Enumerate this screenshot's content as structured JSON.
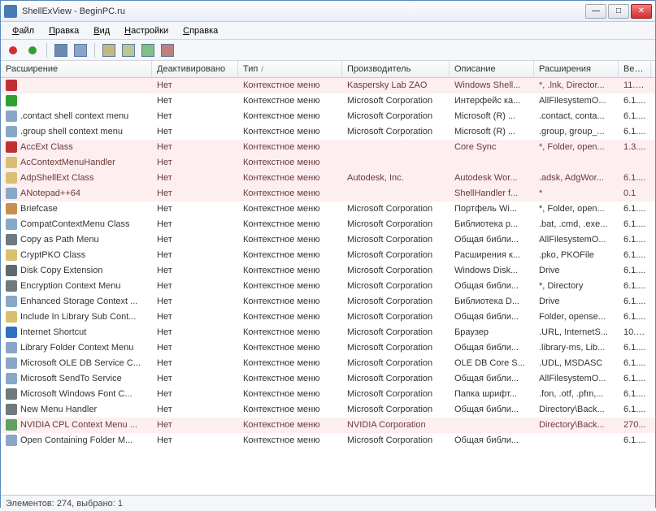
{
  "window": {
    "title": "ShellExView - BeginPC.ru"
  },
  "menu": {
    "file": "Файл",
    "edit": "Правка",
    "view": "Вид",
    "settings": "Настройки",
    "help": "Справка"
  },
  "columns": {
    "ext": "Расширение",
    "disabled": "Деактивировано",
    "type": "Тип",
    "sort": "/",
    "mfr": "Производитель",
    "desc": "Описание",
    "exts": "Расширения",
    "ver": "Вер..."
  },
  "rows": [
    {
      "icon": "#c03030",
      "name": "",
      "disabled": "Нет",
      "type": "Контекстное меню",
      "mfr": "Kaspersky Lab ZAO",
      "desc": "Windows Shell...",
      "exts": "*, .lnk, Director...",
      "ver": "11.0...",
      "pink": true
    },
    {
      "icon": "#30a030",
      "name": "",
      "disabled": "Нет",
      "type": "Контекстное меню",
      "mfr": "Microsoft Corporation",
      "desc": "Интерфейс ка...",
      "exts": "AllFilesystemO...",
      "ver": "6.1....",
      "pink": false
    },
    {
      "icon": "#88a8c8",
      "name": ".contact shell context menu",
      "disabled": "Нет",
      "type": "Контекстное меню",
      "mfr": "Microsoft Corporation",
      "desc": "Microsoft (R) ...",
      "exts": ".contact, conta...",
      "ver": "6.1....",
      "pink": false
    },
    {
      "icon": "#88a8c8",
      "name": ".group shell context menu",
      "disabled": "Нет",
      "type": "Контекстное меню",
      "mfr": "Microsoft Corporation",
      "desc": "Microsoft (R) ...",
      "exts": ".group, group_...",
      "ver": "6.1....",
      "pink": false
    },
    {
      "icon": "#c03030",
      "name": "AccExt Class",
      "disabled": "Нет",
      "type": "Контекстное меню",
      "mfr": "",
      "desc": "Core Sync",
      "exts": "*, Folder, open...",
      "ver": "1.3....",
      "pink": true
    },
    {
      "icon": "#d8c070",
      "name": "AcContextMenuHandler",
      "disabled": "Нет",
      "type": "Контекстное меню",
      "mfr": "",
      "desc": "",
      "exts": "",
      "ver": "",
      "pink": true
    },
    {
      "icon": "#d8c070",
      "name": "AdpShellExt Class",
      "disabled": "Нет",
      "type": "Контекстное меню",
      "mfr": "Autodesk, Inc.",
      "desc": "Autodesk Wor...",
      "exts": ".adsk, AdgWor...",
      "ver": "6.1....",
      "pink": true
    },
    {
      "icon": "#88a8c8",
      "name": "ANotepad++64",
      "disabled": "Нет",
      "type": "Контекстное меню",
      "mfr": "",
      "desc": "ShellHandler f...",
      "exts": "*",
      "ver": "0.1",
      "pink": true
    },
    {
      "icon": "#c89050",
      "name": "Briefcase",
      "disabled": "Нет",
      "type": "Контекстное меню",
      "mfr": "Microsoft Corporation",
      "desc": "Портфель Wi...",
      "exts": "*, Folder, open...",
      "ver": "6.1....",
      "pink": false
    },
    {
      "icon": "#88a8c8",
      "name": "CompatContextMenu Class",
      "disabled": "Нет",
      "type": "Контекстное меню",
      "mfr": "Microsoft Corporation",
      "desc": "Библиотека р...",
      "exts": ".bat, .cmd, .exe...",
      "ver": "6.1....",
      "pink": false
    },
    {
      "icon": "#707880",
      "name": "Copy as Path Menu",
      "disabled": "Нет",
      "type": "Контекстное меню",
      "mfr": "Microsoft Corporation",
      "desc": "Общая библи...",
      "exts": "AllFilesystemO...",
      "ver": "6.1....",
      "pink": false
    },
    {
      "icon": "#d8c070",
      "name": "CryptPKO Class",
      "disabled": "Нет",
      "type": "Контекстное меню",
      "mfr": "Microsoft Corporation",
      "desc": "Расширения к...",
      "exts": ".pko, PKOFile",
      "ver": "6.1....",
      "pink": false
    },
    {
      "icon": "#606870",
      "name": "Disk Copy Extension",
      "disabled": "Нет",
      "type": "Контекстное меню",
      "mfr": "Microsoft Corporation",
      "desc": "Windows Disk...",
      "exts": "Drive",
      "ver": "6.1....",
      "pink": false
    },
    {
      "icon": "#707880",
      "name": "Encryption Context Menu",
      "disabled": "Нет",
      "type": "Контекстное меню",
      "mfr": "Microsoft Corporation",
      "desc": "Общая библи...",
      "exts": "*, Directory",
      "ver": "6.1....",
      "pink": false
    },
    {
      "icon": "#88a8c8",
      "name": "Enhanced Storage Context ...",
      "disabled": "Нет",
      "type": "Контекстное меню",
      "mfr": "Microsoft Corporation",
      "desc": "Библиотека D...",
      "exts": "Drive",
      "ver": "6.1....",
      "pink": false
    },
    {
      "icon": "#d8c070",
      "name": "Include In Library Sub Cont...",
      "disabled": "Нет",
      "type": "Контекстное меню",
      "mfr": "Microsoft Corporation",
      "desc": "Общая библи...",
      "exts": "Folder, opense...",
      "ver": "6.1....",
      "pink": false
    },
    {
      "icon": "#3070c0",
      "name": "Internet Shortcut",
      "disabled": "Нет",
      "type": "Контекстное меню",
      "mfr": "Microsoft Corporation",
      "desc": "Браузер",
      "exts": ".URL, InternetS...",
      "ver": "10.0...",
      "pink": false
    },
    {
      "icon": "#88a8c8",
      "name": "Library Folder Context Menu",
      "disabled": "Нет",
      "type": "Контекстное меню",
      "mfr": "Microsoft Corporation",
      "desc": "Общая библи...",
      "exts": ".library-ms, Lib...",
      "ver": "6.1....",
      "pink": false
    },
    {
      "icon": "#88a8c8",
      "name": "Microsoft OLE DB Service C...",
      "disabled": "Нет",
      "type": "Контекстное меню",
      "mfr": "Microsoft Corporation",
      "desc": "OLE DB Core S...",
      "exts": ".UDL, MSDASC",
      "ver": "6.1....",
      "pink": false
    },
    {
      "icon": "#88a8c8",
      "name": "Microsoft SendTo Service",
      "disabled": "Нет",
      "type": "Контекстное меню",
      "mfr": "Microsoft Corporation",
      "desc": "Общая библи...",
      "exts": "AllFilesystemO...",
      "ver": "6.1....",
      "pink": false
    },
    {
      "icon": "#707880",
      "name": "Microsoft Windows Font C...",
      "disabled": "Нет",
      "type": "Контекстное меню",
      "mfr": "Microsoft Corporation",
      "desc": "Папка шрифт...",
      "exts": ".fon, .otf, .pfm,...",
      "ver": "6.1....",
      "pink": false
    },
    {
      "icon": "#707880",
      "name": "New Menu Handler",
      "disabled": "Нет",
      "type": "Контекстное меню",
      "mfr": "Microsoft Corporation",
      "desc": "Общая библи...",
      "exts": "Directory\\Back...",
      "ver": "6.1....",
      "pink": false
    },
    {
      "icon": "#60a060",
      "name": "NVIDIA CPL Context Menu ...",
      "disabled": "Нет",
      "type": "Контекстное меню",
      "mfr": "NVIDIA Corporation",
      "desc": "",
      "exts": "Directory\\Back...",
      "ver": "270...",
      "pink": true
    },
    {
      "icon": "#88a8c8",
      "name": "Open Containing Folder M...",
      "disabled": "Нет",
      "type": "Контекстное меню",
      "mfr": "Microsoft Corporation",
      "desc": "Общая библи...",
      "exts": "",
      "ver": "6.1....",
      "pink": false
    }
  ],
  "status": {
    "text": "Элементов: 274, выбрано: 1"
  }
}
